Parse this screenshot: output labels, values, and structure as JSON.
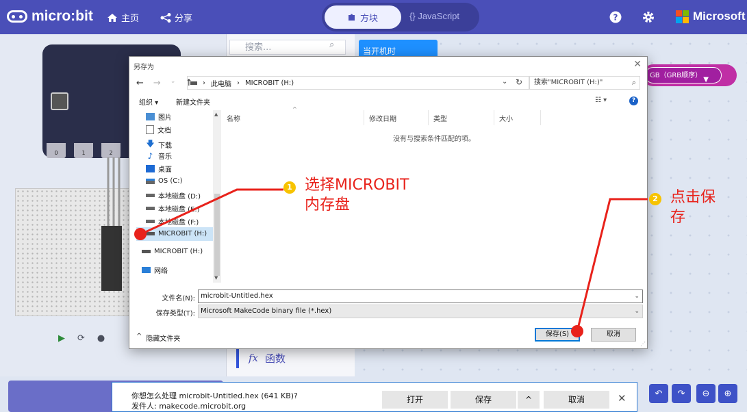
{
  "header": {
    "brand": "micro:bit",
    "nav_home": "主页",
    "nav_share": "分享",
    "mode_blocks": "方块",
    "mode_js": "JavaScript",
    "ms_brand": "Microsoft",
    "colors": {
      "header_bg": "#4a4fb8",
      "ms_red": "#f25022",
      "ms_green": "#7fba00",
      "ms_blue": "#00a4ef",
      "ms_yellow": "#ffb900"
    }
  },
  "simulator": {
    "pins": [
      "0",
      "1",
      "2"
    ]
  },
  "toolbox": {
    "search_placeholder": "搜索...",
    "functions_label": "函数"
  },
  "workspace": {
    "event_block": "当开机时",
    "rgb_dropdown": "GB（GRB顺序）"
  },
  "dialog": {
    "title": "另存为",
    "path_root": "此电脑",
    "path_drive": "MICROBIT (H:)",
    "search_placeholder": "搜索\"MICROBIT (H:)\"",
    "organize": "组织 ▾",
    "new_folder": "新建文件夹",
    "nav_items": [
      {
        "label": "图片",
        "icon": "pictures-icon"
      },
      {
        "label": "文档",
        "icon": "documents-icon"
      },
      {
        "label": "下载",
        "icon": "downloads-icon"
      },
      {
        "label": "音乐",
        "icon": "music-icon"
      },
      {
        "label": "桌面",
        "icon": "desktop-icon"
      },
      {
        "label": "OS (C:)",
        "icon": "os-drive-icon"
      },
      {
        "label": "本地磁盘 (D:)",
        "icon": "drive-icon"
      },
      {
        "label": "本地磁盘 (E:)",
        "icon": "drive-icon"
      },
      {
        "label": "本地磁盘 (F:)",
        "icon": "drive-icon"
      },
      {
        "label": "MICROBIT (H:)",
        "icon": "usb-drive-icon",
        "selected": true
      }
    ],
    "nav_extra": [
      {
        "label": "MICROBIT (H:)",
        "icon": "usb-drive-icon"
      },
      {
        "label": "网络",
        "icon": "network-icon"
      }
    ],
    "columns": [
      "名称",
      "修改日期",
      "类型",
      "大小"
    ],
    "empty_message": "没有与搜索条件匹配的项。",
    "filename_label": "文件名(N):",
    "filename_value": "microbit-Untitled.hex",
    "filetype_label": "保存类型(T):",
    "filetype_value": "Microsoft MakeCode binary file (*.hex)",
    "hide_folders": "隐藏文件夹",
    "save_button": "保存(S)",
    "cancel_button": "取消"
  },
  "annotations": {
    "step1_number": "1",
    "step1_text_line1": "选择MICROBIT",
    "step1_text_line2": "内存盘",
    "step2_number": "2",
    "step2_text_line1": "点击保",
    "step2_text_line2": "存",
    "color": "#e8221b"
  },
  "download_bar": {
    "question": "你想怎么处理 microbit-Untitled.hex (641 KB)?",
    "publisher": "发件人: makecode.microbit.org",
    "open_button": "打开",
    "save_button": "保存",
    "cancel_button": "取消"
  }
}
